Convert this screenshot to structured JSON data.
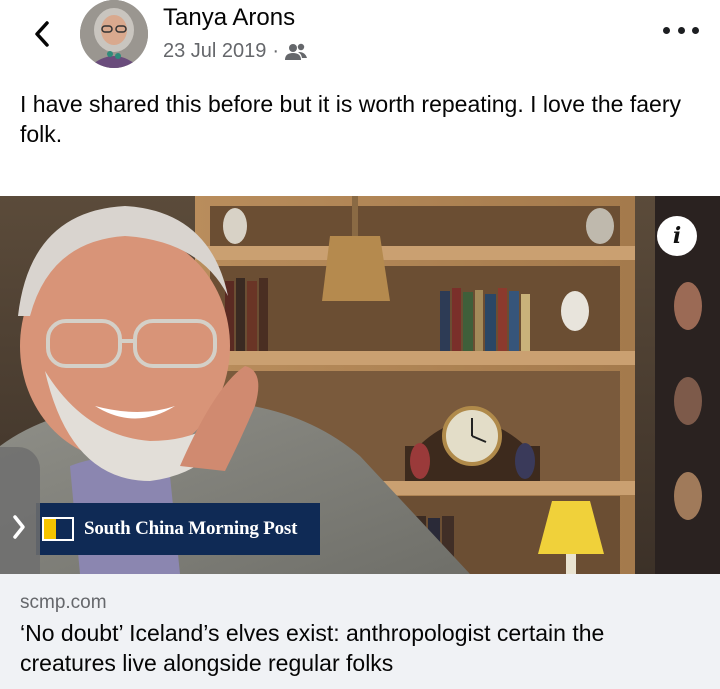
{
  "post": {
    "author_name": "Tanya Arons",
    "date": "23 Jul 2019",
    "separator": "·",
    "audience_icon": "friends-icon",
    "text": "I have shared this before but it is worth repeating.  I love the faery folk."
  },
  "nav": {
    "back_icon": "chevron-left-icon",
    "more_icon": "more-horizontal-icon"
  },
  "link_preview": {
    "info_label": "i",
    "source_brand": "South China Morning Post",
    "domain": "scmp.com",
    "headline": "‘No doubt’ Iceland’s elves exist: anthropologist certain the creatures live alongside regular folks"
  },
  "colors": {
    "brand_navy": "#0f2a55",
    "brand_yellow": "#f5c400",
    "card_bg": "#f0f2f5",
    "secondary_text": "#65676b"
  }
}
